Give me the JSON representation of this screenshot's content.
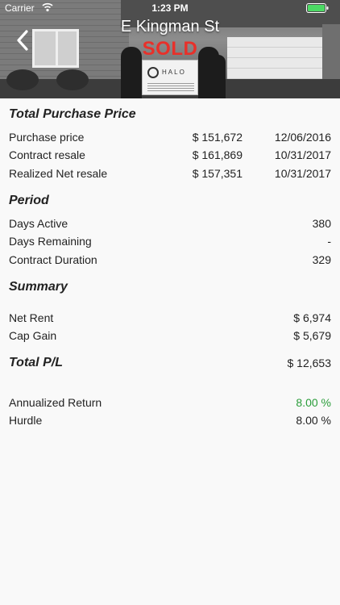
{
  "status_bar": {
    "carrier": "Carrier",
    "time": "1:23 PM"
  },
  "header": {
    "title": "E Kingman St",
    "badge": "SOLD",
    "sign_text": "HALO"
  },
  "purchase": {
    "title": "Total Purchase Price",
    "rows": [
      {
        "label": "Purchase price",
        "amount": "$ 151,672",
        "date": "12/06/2016"
      },
      {
        "label": "Contract resale",
        "amount": "$ 161,869",
        "date": "10/31/2017"
      },
      {
        "label": "Realized Net resale",
        "amount": "$ 157,351",
        "date": "10/31/2017"
      }
    ]
  },
  "period": {
    "title": "Period",
    "rows": [
      {
        "label": "Days Active",
        "value": "380"
      },
      {
        "label": "Days Remaining",
        "value": "-"
      },
      {
        "label": "Contract Duration",
        "value": "329"
      }
    ]
  },
  "summary": {
    "title": "Summary",
    "rows": [
      {
        "label": "Net Rent",
        "value": "$ 6,974"
      },
      {
        "label": "Cap Gain",
        "value": "$ 5,679"
      }
    ]
  },
  "total": {
    "label": "Total P/L",
    "value": "$ 12,653"
  },
  "returns": {
    "rows": [
      {
        "label": "Annualized Return",
        "value": "8.00 %"
      },
      {
        "label": "Hurdle",
        "value": "8.00 %"
      }
    ]
  },
  "colors": {
    "sold_badge": "#e8302a",
    "positive": "#2a9d3a",
    "battery": "#4cd964"
  },
  "icons": {
    "back": "chevron-left-icon",
    "wifi": "wifi-icon",
    "battery": "battery-icon"
  }
}
